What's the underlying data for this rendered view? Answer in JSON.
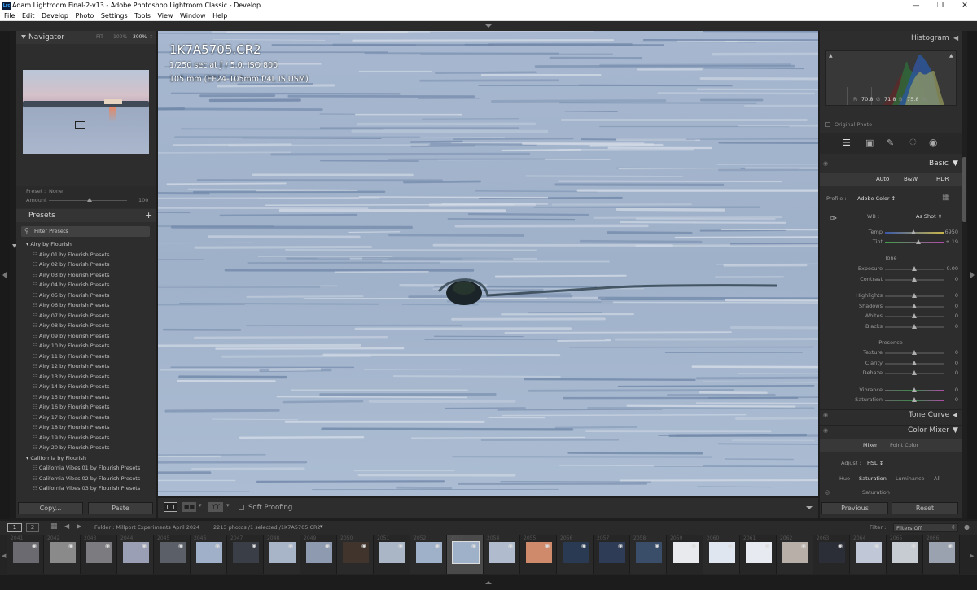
{
  "window": {
    "title": "Adam Lightroom Final-2-v13 - Adobe Photoshop Lightroom Classic - Develop",
    "icon_text": "Lrc"
  },
  "menu": [
    "File",
    "Edit",
    "Develop",
    "Photo",
    "Settings",
    "Tools",
    "View",
    "Window",
    "Help"
  ],
  "navigator": {
    "title": "Navigator",
    "zoom_options": [
      "FIT",
      "100%",
      "300%"
    ]
  },
  "preset_amount": {
    "preset_label": "Preset",
    "preset_value": "None",
    "amount_label": "Amount",
    "amount_value": "100"
  },
  "presets": {
    "title": "Presets",
    "filter_placeholder": "Filter Presets",
    "groups": [
      {
        "name": "Airy by Flourish",
        "items": [
          "Airy 01 by Flourish Presets",
          "Airy 02 by Flourish Presets",
          "Airy 03 by Flourish Presets",
          "Airy 04 by Flourish Presets",
          "Airy 05 by Flourish Presets",
          "Airy 06 by Flourish Presets",
          "Airy 07 by Flourish Presets",
          "Airy 08 by Flourish Presets",
          "Airy 09 by Flourish Presets",
          "Airy 10 by Flourish Presets",
          "Airy 11 by Flourish Presets",
          "Airy 12 by Flourish Presets",
          "Airy 13 by Flourish Presets",
          "Airy 14 by Flourish Presets",
          "Airy 15 by Flourish Presets",
          "Airy 16 by Flourish Presets",
          "Airy 17 by Flourish Presets",
          "Airy 18 by Flourish Presets",
          "Airy 19 by Flourish Presets",
          "Airy 20 by Flourish Presets"
        ]
      },
      {
        "name": "California by Flourish",
        "items": [
          "California Vibes 01 by Flourish Presets",
          "California Vibes 02 by Flourish Presets",
          "California Vibes 03 by Flourish Presets"
        ]
      }
    ]
  },
  "left_buttons": {
    "copy": "Copy...",
    "paste": "Paste"
  },
  "photo_info": {
    "filename": "1K7A5705.CR2",
    "exposure": "1/250 sec at ƒ / 5.0, ISO 800",
    "lens": "105 mm (EF24-105mm f/4L IS USM)"
  },
  "toolbar": {
    "soft_proofing": "Soft Proofing"
  },
  "histogram": {
    "title": "Histogram",
    "r_label": "R",
    "r_value": "70.8",
    "g_label": "G",
    "g_value": "71.8",
    "b_label": "B",
    "b_value": "75.8",
    "pct": "%",
    "original_photo": "Original Photo"
  },
  "basic": {
    "title": "Basic",
    "modes": [
      "Auto",
      "B&W",
      "HDR"
    ],
    "profile_label": "Profile :",
    "profile_value": "Adobe Color ↕",
    "wb_label": "WB :",
    "wb_value": "As Shot ↕",
    "temp": {
      "label": "Temp",
      "value": "6950"
    },
    "tint": {
      "label": "Tint",
      "value": "+ 19"
    },
    "tone_title": "Tone",
    "tone": [
      {
        "label": "Exposure",
        "value": "0.00"
      },
      {
        "label": "Contrast",
        "value": "0"
      },
      {
        "label": "Highlights",
        "value": "0"
      },
      {
        "label": "Shadows",
        "value": "0"
      },
      {
        "label": "Whites",
        "value": "0"
      },
      {
        "label": "Blacks",
        "value": "0"
      }
    ],
    "presence_title": "Presence",
    "presence": [
      {
        "label": "Texture",
        "value": "0"
      },
      {
        "label": "Clarity",
        "value": "0"
      },
      {
        "label": "Dehaze",
        "value": "0"
      },
      {
        "label": "Vibrance",
        "value": "0"
      },
      {
        "label": "Saturation",
        "value": "0"
      }
    ]
  },
  "tone_curve": {
    "title": "Tone Curve"
  },
  "color_mixer": {
    "title": "Color Mixer",
    "tabs": [
      "Mixer",
      "Point Color"
    ],
    "adjust_label": "Adjust :",
    "adjust_value": "HSL ↕",
    "subtabs": [
      "Hue",
      "Saturation",
      "Luminance",
      "All"
    ],
    "section": "Saturation"
  },
  "right_buttons": {
    "previous": "Previous",
    "reset": "Reset"
  },
  "filmstrip": {
    "screens": [
      "1",
      "2"
    ],
    "folder": "Folder : Millport Experiments April 2024",
    "count": "2213 photos /1 selected /1K7A5705.CR2",
    "filter_label": "Filter :",
    "filter_value": "Filters Off",
    "numbers": [
      "2041",
      "2042",
      "2043",
      "2044",
      "2045",
      "2046",
      "2047",
      "2048",
      "2049",
      "2050",
      "2051",
      "2052",
      "2053",
      "2054",
      "2055",
      "2056",
      "2057",
      "2058",
      "2059",
      "2060",
      "2061",
      "2062",
      "2063",
      "2064",
      "2065",
      "2066"
    ]
  },
  "colors": {
    "accent": "#3aa8ff",
    "panel": "#2d2d2d",
    "water": "#93a9c6"
  }
}
